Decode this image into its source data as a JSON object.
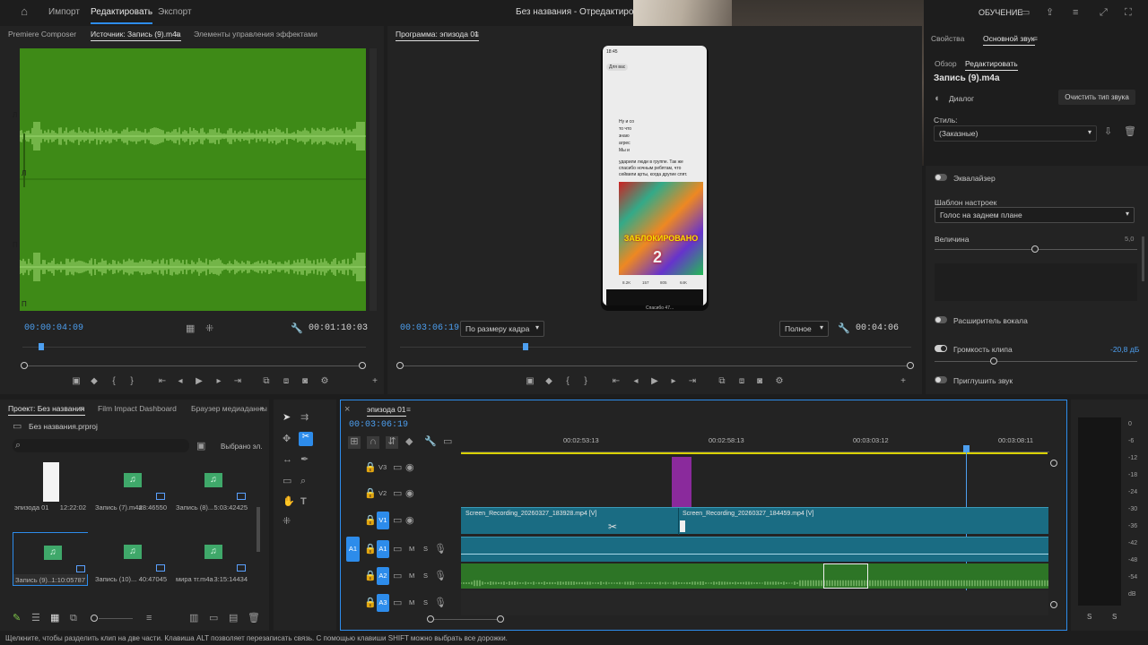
{
  "topbar": {
    "menu_import": "Импорт",
    "menu_edit": "Редактировать",
    "menu_export": "Экспорт",
    "window_title": "Без названия - Отредактировано",
    "learning": "ОБУЧЕНИЕ"
  },
  "source_panel": {
    "tab_composer": "Premiere Composer",
    "tab_source": "Источник: Запись (9).m4a",
    "tab_effect_controls": "Элементы управления эффектами",
    "channel_labels": [
      "Л",
      "Л",
      "П",
      "П"
    ],
    "timecode_current": "00:00:04:09",
    "timecode_duration": "00:01:10:03"
  },
  "program_panel": {
    "tab": "Программа: эпизода 01",
    "timecode_current": "00:03:06:19",
    "fit_dropdown": "По размеру кадра",
    "quality_dropdown": "Полное",
    "timecode_duration": "00:04:06",
    "phone_texts": [
      "Для вас",
      "Ну и со",
      "то что",
      "знаю",
      "агрес",
      "Мы и",
      "ударили люди в группе. Так же",
      "спасибо ночным ребятам, что",
      "сейвили арты, когда другие спят."
    ],
    "blocked_label": "ЗАБЛОКИРОВАНО",
    "stats": [
      "8.2K",
      "157",
      "805",
      "64K"
    ],
    "footer_text": "Спасибо 47..."
  },
  "right_panel": {
    "tab_properties": "Свойства",
    "tab_essential_sound": "Основной звук",
    "subtab_overview": "Обзор",
    "subtab_edit": "Редактировать",
    "clip_name": "Запись (9).m4a",
    "dialog_label": "Диалог",
    "clear_button": "Очистить тип звука",
    "style_label": "Стиль:",
    "style_value": "(Заказные)",
    "equalizer_label": "Эквалайзер",
    "preset_label": "Шаблон настроек",
    "preset_value": "Голос на заднем плане",
    "amount_label": "Величина",
    "amount_value": "5,0",
    "vocal_enhancer": "Расширитель вокала",
    "clip_volume": "Громкость клипа",
    "clip_volume_value": "-20,8 дБ",
    "mute": "Приглушить звук"
  },
  "project_panel": {
    "tab_project": "Проект: Без названия",
    "tab_film_impact": "Film Impact Dashboard",
    "tab_media_browser": "Браузер медиаданны",
    "project_file": "Без названия.prproj",
    "selected_label": "Выбрано эл.",
    "items": [
      {
        "name": "эпизода 01",
        "duration": "12:22:02",
        "kind": "sequence"
      },
      {
        "name": "Запись (7).m4a",
        "duration": "28:46550",
        "kind": "audio"
      },
      {
        "name": "Запись (8)...",
        "duration": "5:03:42425",
        "kind": "audio"
      },
      {
        "name": "Запись (9)...",
        "duration": "1:10:05787",
        "kind": "audio"
      },
      {
        "name": "Запись (10)...",
        "duration": "40:47045",
        "kind": "audio"
      },
      {
        "name": "мира тг.m4a",
        "duration": "3:15:14434",
        "kind": "audio"
      }
    ]
  },
  "timeline": {
    "tab": "эпизода 01",
    "timecode": "00:03:06:19",
    "ruler_labels": [
      "00:02:53:13",
      "00:02:58:13",
      "00:03:03:12",
      "00:03:08:11"
    ],
    "tracks": [
      {
        "id": "V3",
        "target": ""
      },
      {
        "id": "V2",
        "target": ""
      },
      {
        "id": "V1",
        "target": "V1"
      },
      {
        "id": "A1",
        "target": "A1"
      },
      {
        "id": "A2",
        "target": ""
      },
      {
        "id": "A3",
        "target": ""
      }
    ],
    "clip_v1_a": "Screen_Recording_20260327_183928.mp4 [V]",
    "clip_v1_b": "Screen_Recording_20260327_184459.mp4 [V]",
    "track_buttons": {
      "mute": "M",
      "solo": "S"
    }
  },
  "audio_meter": {
    "scale": [
      "0",
      "-6",
      "-12",
      "-18",
      "-24",
      "-30",
      "-36",
      "-42",
      "-48",
      "-54",
      "dB"
    ],
    "solo_left": "S",
    "solo_right": "S"
  },
  "statusbar": {
    "text": "Щелкните, чтобы разделить клип на две части. Клавиша ALT позволяет перезаписать связь. С помощью клавиши SHIFT можно выбрать все дорожки."
  },
  "colors": {
    "accent": "#2d8ceb",
    "waveform_bg": "#3e8a17",
    "video_clip": "#1a6c83",
    "audio_clip": "#2d7526",
    "marker_purple": "#8a2a9c"
  }
}
